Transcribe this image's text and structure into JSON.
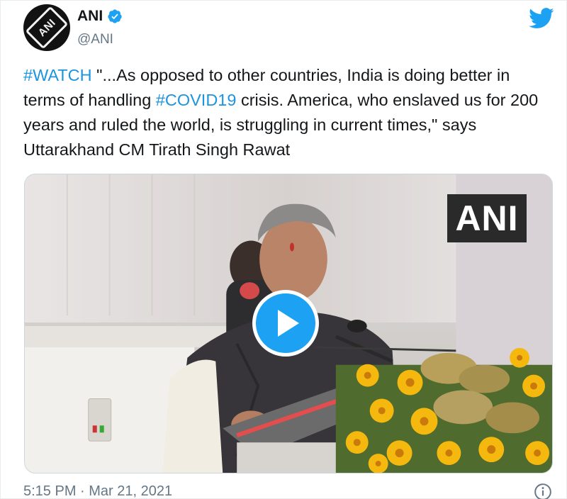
{
  "account": {
    "display_name": "ANI",
    "handle": "@ANI",
    "verified": true,
    "avatar_text": "ANI",
    "avatar_icon": "ani-logo-icon"
  },
  "header": {
    "brand_icon": "twitter-bird-icon",
    "brand_color": "#1da1f2"
  },
  "tweet": {
    "hashtag_watch": "#WATCH",
    "text_part_1": " \"...As opposed to other countries, India is doing better in terms of handling ",
    "hashtag_covid": "#COVID19",
    "text_part_2": " crisis. America, who enslaved us for 200 years and ruled the world, is struggling in current times,\" says Uttarakhand CM Tirath Singh Rawat",
    "hashtag_color": "#1b95e0"
  },
  "media": {
    "type": "video",
    "watermark": "ANI",
    "play_icon": "play-icon",
    "play_color": "#1da1f2"
  },
  "footer": {
    "timestamp": "5:15 PM · Mar 21, 2021",
    "info_icon": "info-icon"
  }
}
